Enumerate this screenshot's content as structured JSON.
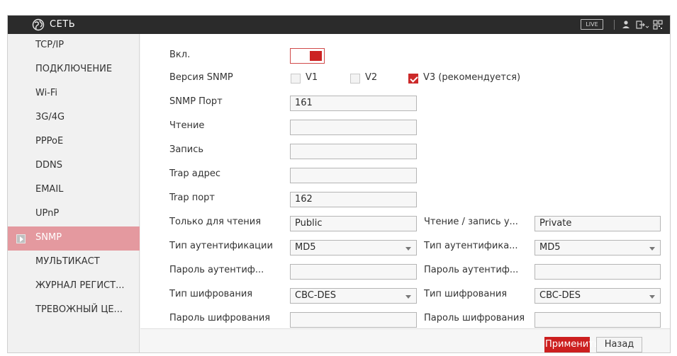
{
  "window": {
    "title": "СЕТЬ",
    "live_label": "LIVE"
  },
  "icons": {
    "logo": "globe-logo-icon",
    "user": "user-icon",
    "exit": "logout-icon",
    "qr": "qr-code-icon"
  },
  "colors": {
    "accent": "#cc1f1f",
    "active_nav": "#e4999f",
    "titlebar": "#2b2b2b"
  },
  "sidebar": {
    "items": [
      {
        "label": "TCP/IP",
        "active": false
      },
      {
        "label": "ПОДКЛЮЧЕНИЕ",
        "active": false
      },
      {
        "label": "Wi-Fi",
        "active": false
      },
      {
        "label": "3G/4G",
        "active": false
      },
      {
        "label": "PPPoE",
        "active": false
      },
      {
        "label": "DDNS",
        "active": false
      },
      {
        "label": "EMAIL",
        "active": false
      },
      {
        "label": "UPnP",
        "active": false
      },
      {
        "label": "SNMP",
        "active": true
      },
      {
        "label": "МУЛЬТИКАСТ",
        "active": false
      },
      {
        "label": "ЖУРНАЛ РЕГИСТ...",
        "active": false
      },
      {
        "label": "ТРЕВОЖНЫЙ ЦЕ...",
        "active": false
      }
    ]
  },
  "form": {
    "enable": {
      "label": "Вкл.",
      "on": true
    },
    "version": {
      "label": "Версия SNMP",
      "v1": {
        "label": "V1",
        "checked": false
      },
      "v2": {
        "label": "V2",
        "checked": false
      },
      "v3": {
        "label": "V3 (рекомендуется)",
        "checked": true
      }
    },
    "snmp_port": {
      "label": "SNMP Порт",
      "value": "161"
    },
    "read": {
      "label": "Чтение",
      "value": ""
    },
    "write": {
      "label": "Запись",
      "value": ""
    },
    "trap_address": {
      "label": "Trap адрес",
      "value": ""
    },
    "trap_port": {
      "label": "Trap порт",
      "value": "162"
    },
    "readonly_user": {
      "label": "Только для чтения",
      "value": "Public"
    },
    "readwrite_user": {
      "label": "Чтение / запись у...",
      "value": "Private"
    },
    "auth_type_1": {
      "label": "Тип аутентификации",
      "value": "MD5"
    },
    "auth_type_2": {
      "label": "Тип аутентифика...",
      "value": "MD5"
    },
    "auth_pass_1": {
      "label": "Пароль аутентиф...",
      "value": ""
    },
    "auth_pass_2": {
      "label": "Пароль аутентиф...",
      "value": ""
    },
    "enc_type_1": {
      "label": "Тип шифрования",
      "value": "CBC-DES"
    },
    "enc_type_2": {
      "label": "Тип шифрования",
      "value": "CBC-DES"
    },
    "enc_pass_1": {
      "label": "Пароль шифрования",
      "value": ""
    },
    "enc_pass_2": {
      "label": "Пароль шифрования",
      "value": ""
    }
  },
  "footer": {
    "apply_label": "Применить",
    "back_label": "Назад"
  }
}
